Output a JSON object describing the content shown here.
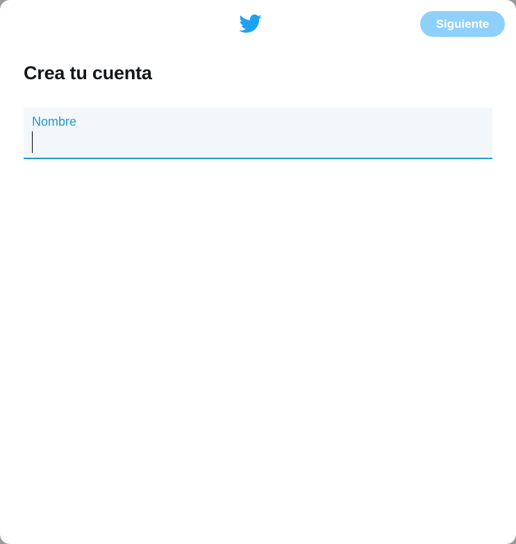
{
  "header": {
    "logo_icon": "twitter-bird-icon",
    "next_label": "Siguiente"
  },
  "form": {
    "title": "Crea tu cuenta",
    "name_field": {
      "label": "Nombre",
      "value": ""
    }
  },
  "colors": {
    "brand": "#1da1f2",
    "button_disabled": "#8ed0f9",
    "field_focus": "#1d9bd1",
    "field_bg": "#f3f7f9",
    "text": "#14171a"
  }
}
